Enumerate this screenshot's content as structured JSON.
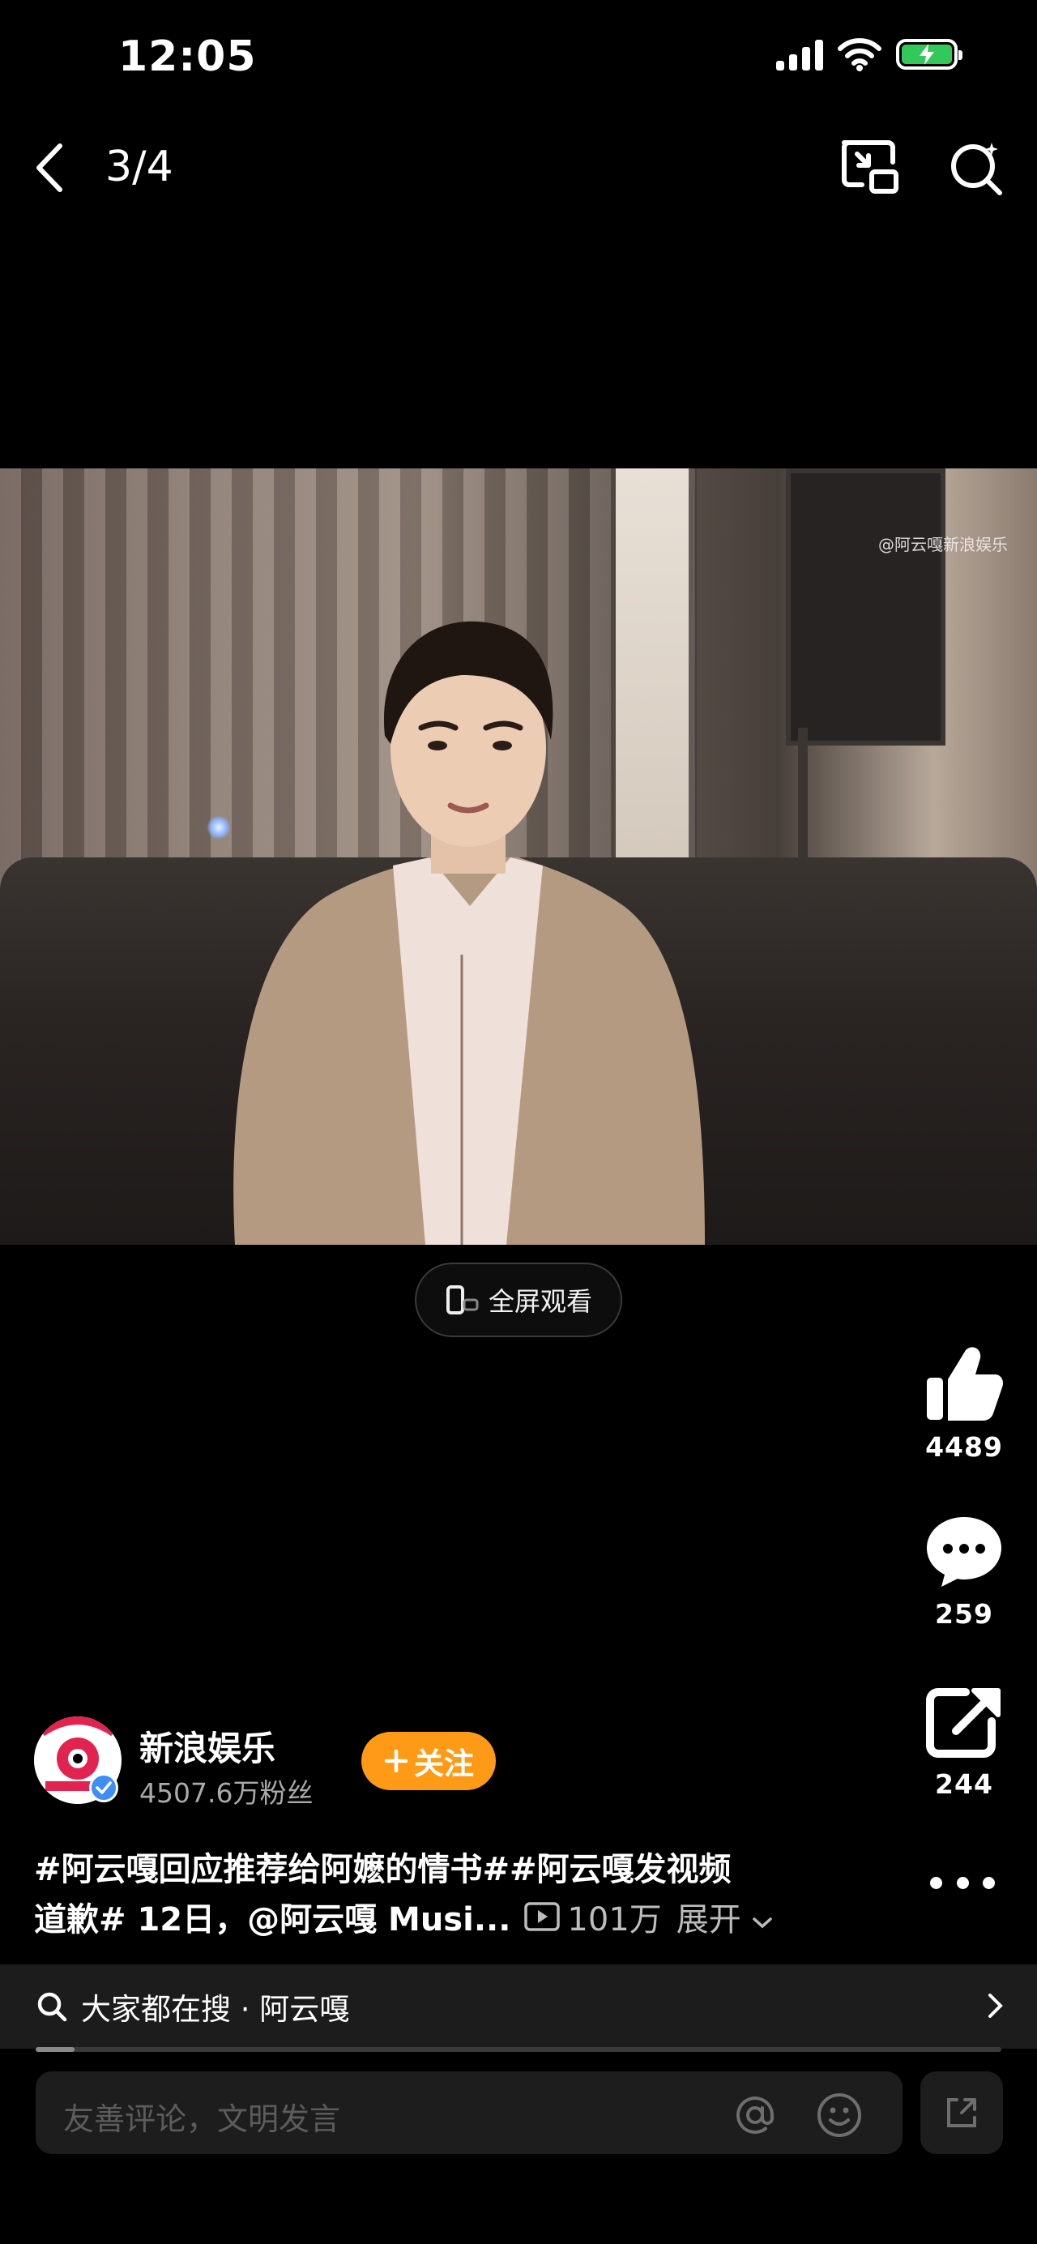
{
  "status_bar": {
    "time": "12:05"
  },
  "nav": {
    "page_indicator": "3/4"
  },
  "video": {
    "watermark": "@阿云嘎新浪娱乐"
  },
  "fullscreen_label": "全屏观看",
  "actions": {
    "likes": "4489",
    "comments": "259",
    "shares": "244"
  },
  "author": {
    "name": "新浪娱乐",
    "fans": "4507.6万粉丝",
    "follow_label": "关注"
  },
  "caption": {
    "line1": "#阿云嘎回应推荐给阿嬷的情书##阿云嘎发视频",
    "line2": "道歉# 12日，@阿云嘎 Musi...",
    "views": "101万",
    "expand": "展开"
  },
  "search_suggest": {
    "text": "大家都在搜 · 阿云嘎"
  },
  "progress": {
    "fraction": 0.04
  },
  "comment_input": {
    "placeholder": "友善评论，文明发言"
  },
  "colors": {
    "follow": "#ff9a16",
    "battery": "#33c85a",
    "verified": "#3f8ef5"
  }
}
